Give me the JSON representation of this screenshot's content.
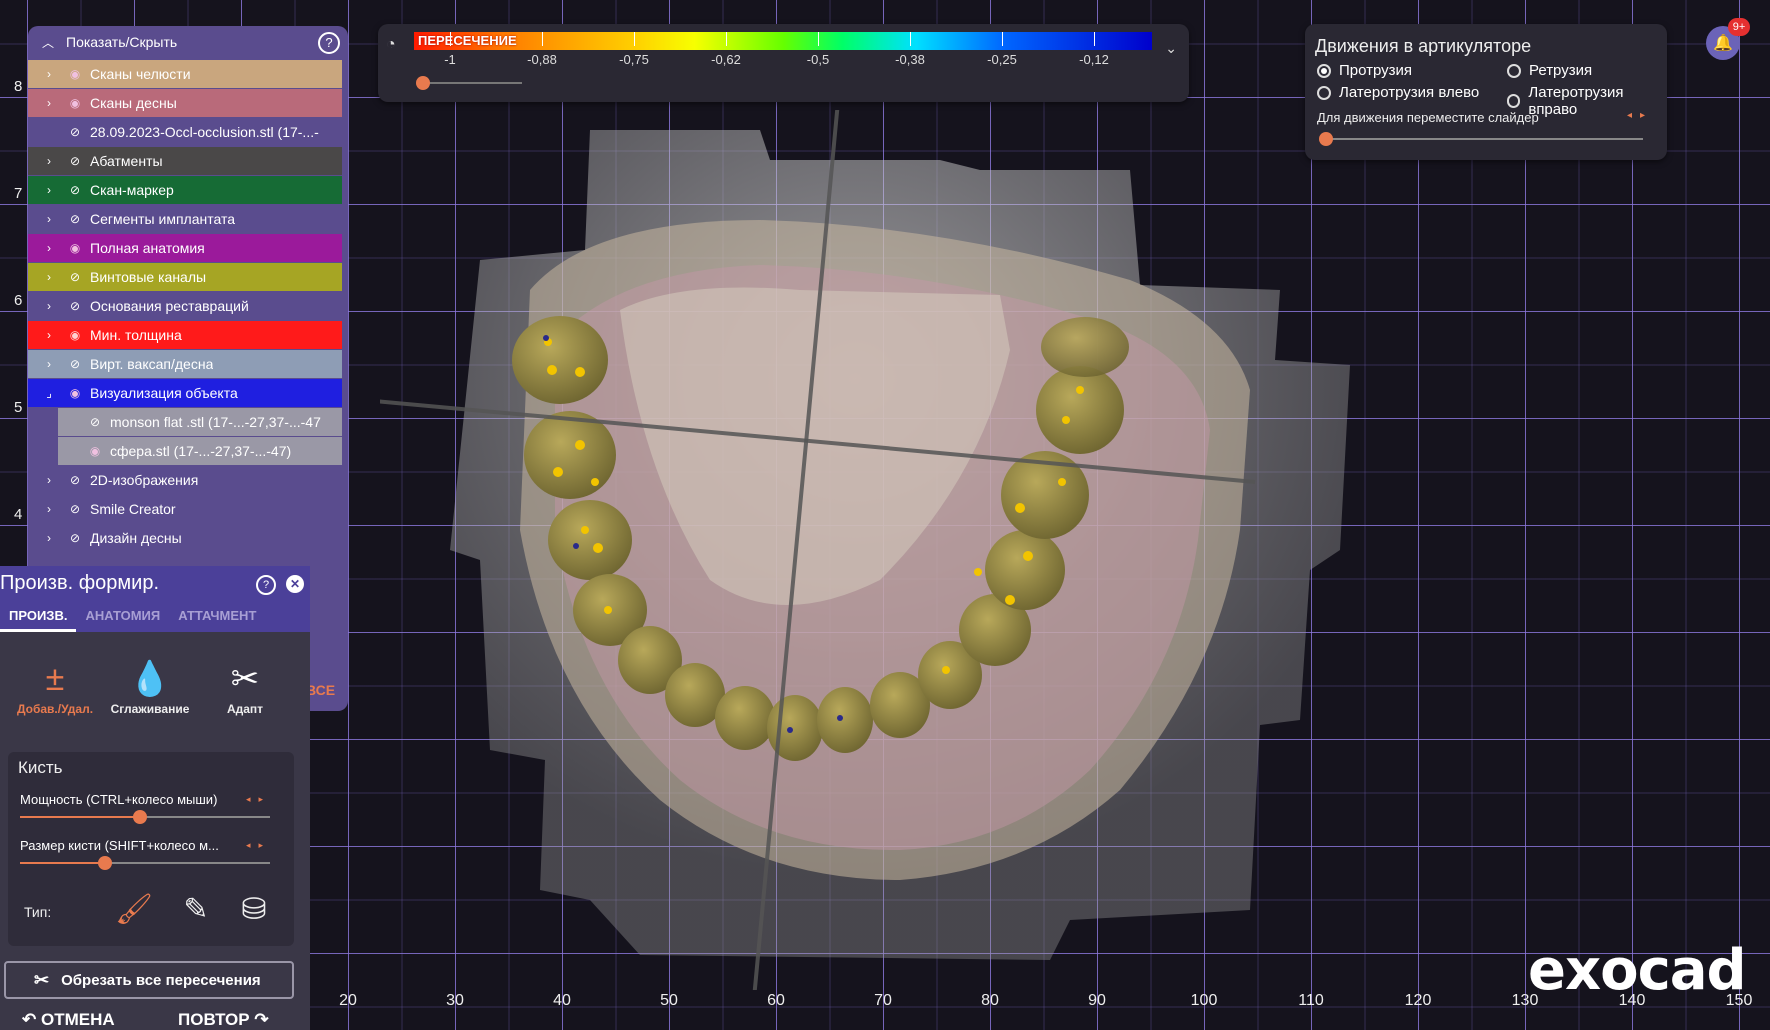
{
  "colorbar": {
    "label": "ПЕРЕСЕЧЕНИЕ",
    "ticks": [
      "-1",
      "-0,88",
      "-0,75",
      "-0,62",
      "-0,5",
      "-0,38",
      "-0,25",
      "-0,12"
    ],
    "icon": "gauge-icon",
    "collapse_icon": "chevron-down-icon",
    "slider_value": 0.0
  },
  "articulator": {
    "title": "Движения в артикуляторе",
    "options": [
      {
        "label": "Протрузия",
        "selected": true
      },
      {
        "label": "Ретрузия",
        "selected": false
      },
      {
        "label": "Латеротрузия влево",
        "selected": false
      },
      {
        "label": "Латеротрузия вправо",
        "selected": false
      }
    ],
    "hint": "Для движения переместите слайдер",
    "slider_value": 0.0
  },
  "notifications": {
    "badge": "9+",
    "icon": "bell-icon"
  },
  "logo": "exocad",
  "layers": {
    "header": "Показать/Скрыть",
    "show_all": "ВСЕ",
    "items": [
      {
        "label": "Сканы челюсти",
        "color": "#c9a67e",
        "visible": true,
        "expandable": true
      },
      {
        "label": "Сканы десны",
        "color": "#b96a7a",
        "visible": true,
        "expandable": true
      },
      {
        "label": "28.09.2023-Occl-occlusion.stl (17-...-",
        "color": "#5a4c8e",
        "visible": false,
        "expandable": false,
        "sub": false
      },
      {
        "label": "Абатменты",
        "color": "#4a4848",
        "visible": false,
        "expandable": true
      },
      {
        "label": "Скан-маркер",
        "color": "#166b35",
        "visible": false,
        "expandable": true
      },
      {
        "label": "Сегменты имплантата",
        "color": "#5a4c8e",
        "visible": false,
        "expandable": true
      },
      {
        "label": "Полная анатомия",
        "color": "#9b1a9b",
        "visible": true,
        "expandable": true
      },
      {
        "label": "Винтовые каналы",
        "color": "#a6a524",
        "visible": false,
        "expandable": true
      },
      {
        "label": "Основания реставраций",
        "color": "#5a4c8e",
        "visible": false,
        "expandable": true
      },
      {
        "label": "Мин. толщина",
        "color": "#ff1a1a",
        "visible": true,
        "expandable": true
      },
      {
        "label": "Вирт. ваксап/десна",
        "color": "#8e9db5",
        "visible": false,
        "expandable": true
      },
      {
        "label": "Визуализация объекта",
        "color": "#1f1fe0",
        "visible": true,
        "expandable": true,
        "expanded": true
      },
      {
        "label": "monson flat .stl (17-...-27,37-...-47",
        "color": "#9a98a6",
        "visible": false,
        "expandable": false,
        "sub": true
      },
      {
        "label": "сфера.stl (17-...-27,37-...-47)",
        "color": "#9a98a6",
        "visible": true,
        "expandable": false,
        "sub": true
      },
      {
        "label": "2D-изображения",
        "color": "#5a4c8e",
        "visible": false,
        "expandable": true
      },
      {
        "label": "Smile Creator",
        "color": "#5a4c8e",
        "visible": false,
        "expandable": true
      },
      {
        "label": "Дизайн десны",
        "color": "#5a4c8e",
        "visible": false,
        "expandable": true
      }
    ]
  },
  "tool": {
    "title": "Произв. формир.",
    "tabs": [
      "ПРОИЗВ.",
      "АНАТОМИЯ",
      "АТТАЧМЕНТ"
    ],
    "actions": [
      {
        "label": "Добав./Удал.",
        "icon": "add-remove-icon",
        "active": true
      },
      {
        "label": "Сглаживание",
        "icon": "smooth-drop-icon",
        "active": false
      },
      {
        "label": "Адапт",
        "icon": "adapt-scissors-icon",
        "active": false
      }
    ],
    "brush": {
      "title": "Кисть",
      "strength_label": "Мощность (CTRL+колесо мыши)",
      "strength_value": 0.48,
      "size_label": "Размер кисти (SHIFT+колесо м...",
      "size_value": 0.34,
      "type_label": "Тип:",
      "types": [
        {
          "icon": "paint-roller-icon",
          "active": true
        },
        {
          "icon": "paint-brush-icon",
          "active": false
        },
        {
          "icon": "cylinder-icon",
          "active": false
        }
      ]
    },
    "trim_label": "Обрезать все пересечения",
    "undo": "ОТМЕНА",
    "redo": "ПОВТОР"
  },
  "axis_bottom": [
    "20",
    "30",
    "40",
    "50",
    "60",
    "70",
    "80",
    "90",
    "100",
    "110",
    "120",
    "130",
    "140",
    "150"
  ],
  "axis_left": [
    "8",
    "7",
    "6",
    "5",
    "4"
  ]
}
